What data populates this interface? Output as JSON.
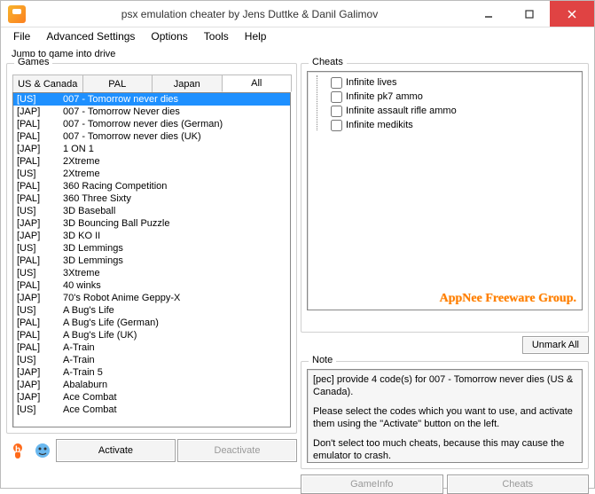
{
  "window": {
    "title": "psx emulation cheater by Jens Duttke & Danil Galimov"
  },
  "menu": {
    "file": "File",
    "advanced": "Advanced Settings",
    "options": "Options",
    "tools": "Tools",
    "help": "Help"
  },
  "jump_label": "Jump to game into drive",
  "games": {
    "legend": "Games",
    "tabs": {
      "us": "US & Canada",
      "pal": "PAL",
      "japan": "Japan",
      "all": "All"
    },
    "list": [
      {
        "region": "[US]",
        "title": "007 - Tomorrow never dies",
        "selected": true
      },
      {
        "region": "[JAP]",
        "title": "007 - Tomorrow Never dies"
      },
      {
        "region": "[PAL]",
        "title": "007 - Tomorrow never dies (German)"
      },
      {
        "region": "[PAL]",
        "title": "007 - Tomorrow never dies (UK)"
      },
      {
        "region": "[JAP]",
        "title": "1 ON 1"
      },
      {
        "region": "[PAL]",
        "title": "2Xtreme"
      },
      {
        "region": "[US]",
        "title": "2Xtreme"
      },
      {
        "region": "[PAL]",
        "title": "360 Racing Competition"
      },
      {
        "region": "[PAL]",
        "title": "360 Three Sixty"
      },
      {
        "region": "[US]",
        "title": "3D Baseball"
      },
      {
        "region": "[JAP]",
        "title": "3D Bouncing Ball Puzzle"
      },
      {
        "region": "[JAP]",
        "title": "3D KO II"
      },
      {
        "region": "[US]",
        "title": "3D Lemmings"
      },
      {
        "region": "[PAL]",
        "title": "3D Lemmings"
      },
      {
        "region": "[US]",
        "title": "3Xtreme"
      },
      {
        "region": "[PAL]",
        "title": "40 winks"
      },
      {
        "region": "[JAP]",
        "title": "70's Robot Anime Geppy-X"
      },
      {
        "region": "[US]",
        "title": "A Bug's Life"
      },
      {
        "region": "[PAL]",
        "title": "A Bug's Life (German)"
      },
      {
        "region": "[PAL]",
        "title": "A Bug's Life (UK)"
      },
      {
        "region": "[PAL]",
        "title": "A-Train"
      },
      {
        "region": "[US]",
        "title": "A-Train"
      },
      {
        "region": "[JAP]",
        "title": "A-Train 5"
      },
      {
        "region": "[JAP]",
        "title": "Abalaburn"
      },
      {
        "region": "[JAP]",
        "title": "Ace Combat"
      },
      {
        "region": "[US]",
        "title": "Ace Combat"
      }
    ]
  },
  "buttons": {
    "activate": "Activate",
    "deactivate": "Deactivate",
    "unmark_all": "Unmark All",
    "gameinfo": "GameInfo",
    "cheats": "Cheats"
  },
  "cheats": {
    "legend": "Cheats",
    "items": [
      "Infinite lives",
      "Infinite pk7 ammo",
      "Infinite assault rifle ammo",
      "Infinite medikits"
    ],
    "watermark": "AppNee Freeware Group."
  },
  "note": {
    "legend": "Note",
    "p1": "[pec] provide 4 code(s) for 007 - Tomorrow never dies (US & Canada).",
    "p2": "Please select the codes which you want to use, and activate them using the \"Activate\" button on the left.",
    "p3": "Don't select too much cheats, because this may cause the emulator to crash."
  }
}
